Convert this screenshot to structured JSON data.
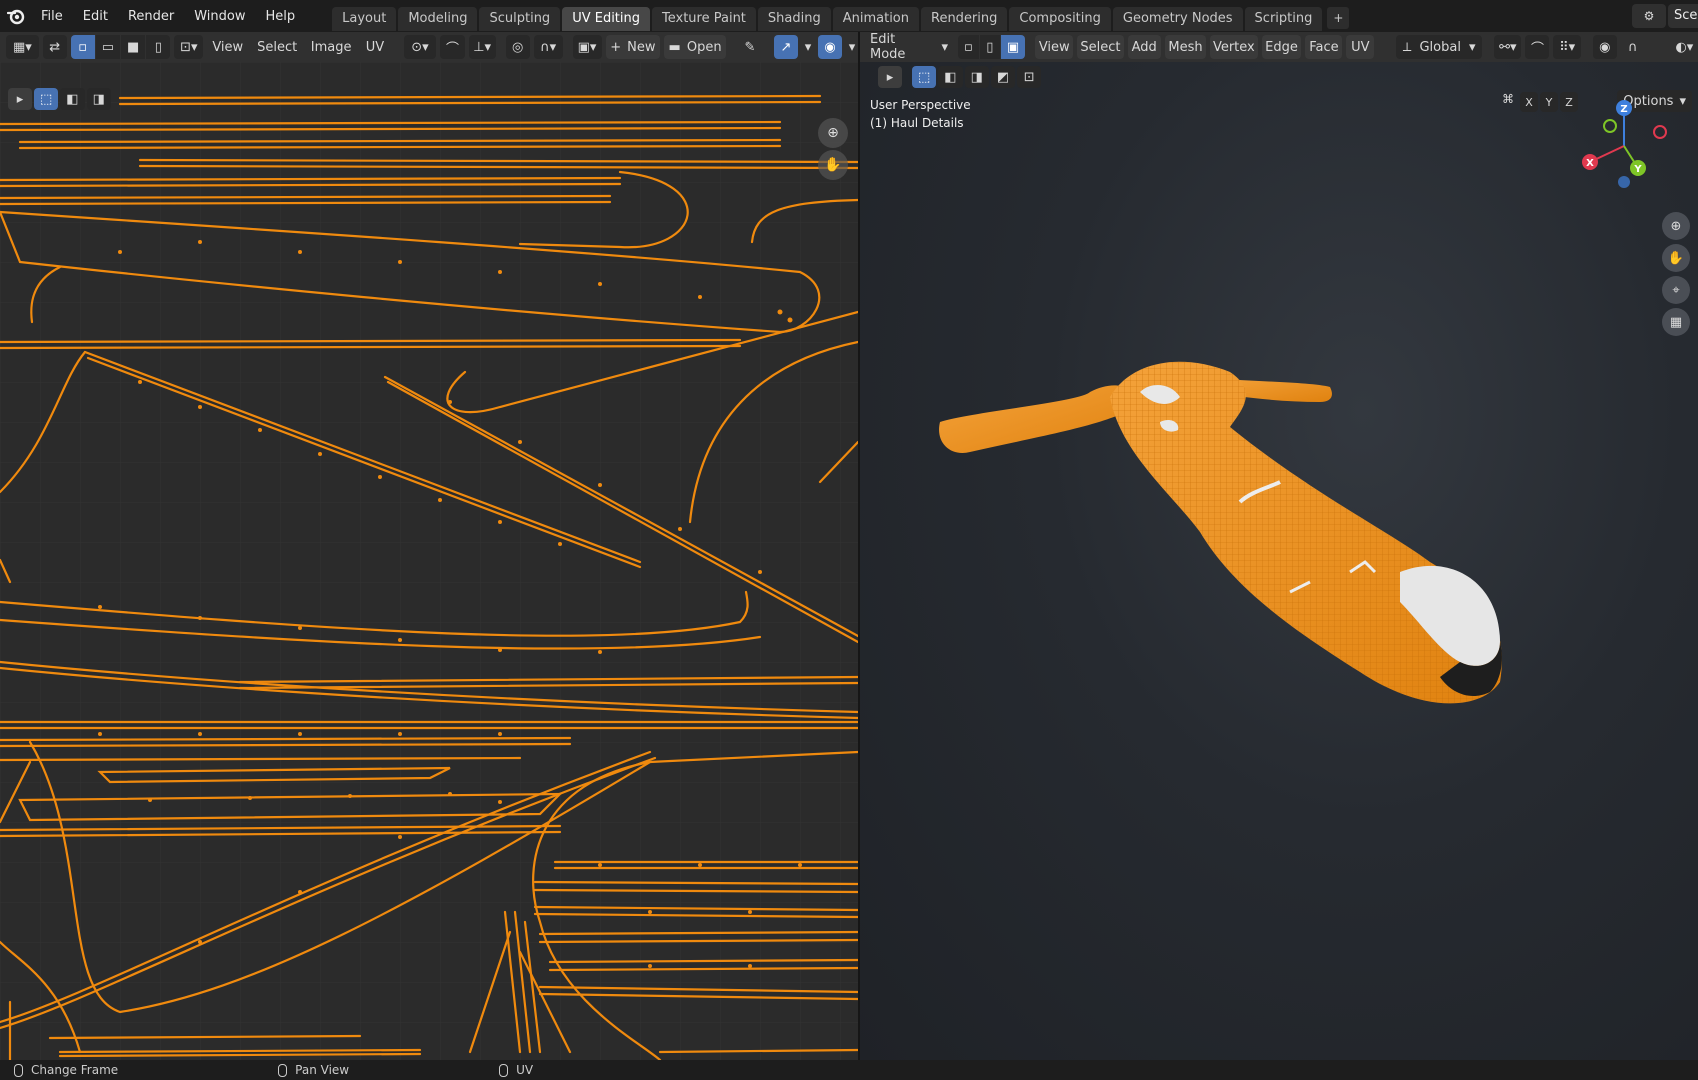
{
  "app": {
    "logo": "blender-logo-icon"
  },
  "menu": [
    "File",
    "Edit",
    "Render",
    "Window",
    "Help"
  ],
  "workspaces": [
    {
      "label": "Layout",
      "active": false
    },
    {
      "label": "Modeling",
      "active": false
    },
    {
      "label": "Sculpting",
      "active": false
    },
    {
      "label": "UV Editing",
      "active": true
    },
    {
      "label": "Texture Paint",
      "active": false
    },
    {
      "label": "Shading",
      "active": false
    },
    {
      "label": "Animation",
      "active": false
    },
    {
      "label": "Rendering",
      "active": false
    },
    {
      "label": "Compositing",
      "active": false
    },
    {
      "label": "Geometry Nodes",
      "active": false
    },
    {
      "label": "Scripting",
      "active": false
    }
  ],
  "add_workspace": "+",
  "scene": {
    "label": "Scen"
  },
  "uv_editor": {
    "menus": [
      "View",
      "Select",
      "Image",
      "UV"
    ],
    "new_label": "New",
    "open_label": "Open",
    "wire_color": "#f08a0e"
  },
  "viewport": {
    "mode": "Edit Mode",
    "menus": [
      "View",
      "Select",
      "Add",
      "Mesh",
      "Vertex",
      "Edge",
      "Face",
      "UV"
    ],
    "orientation": "Global",
    "perspective": "User Perspective",
    "object": "(1) Haul Details",
    "axes": [
      "X",
      "Y",
      "Z"
    ],
    "options": "Options",
    "gizmo": {
      "x": "X",
      "y": "Y",
      "z": "Z",
      "x_color": "#e0394f",
      "y_color": "#7ec527",
      "z_color": "#3e80dd"
    }
  },
  "status": [
    {
      "label": "Change Frame"
    },
    {
      "label": "Pan View"
    },
    {
      "label": "UV"
    }
  ]
}
